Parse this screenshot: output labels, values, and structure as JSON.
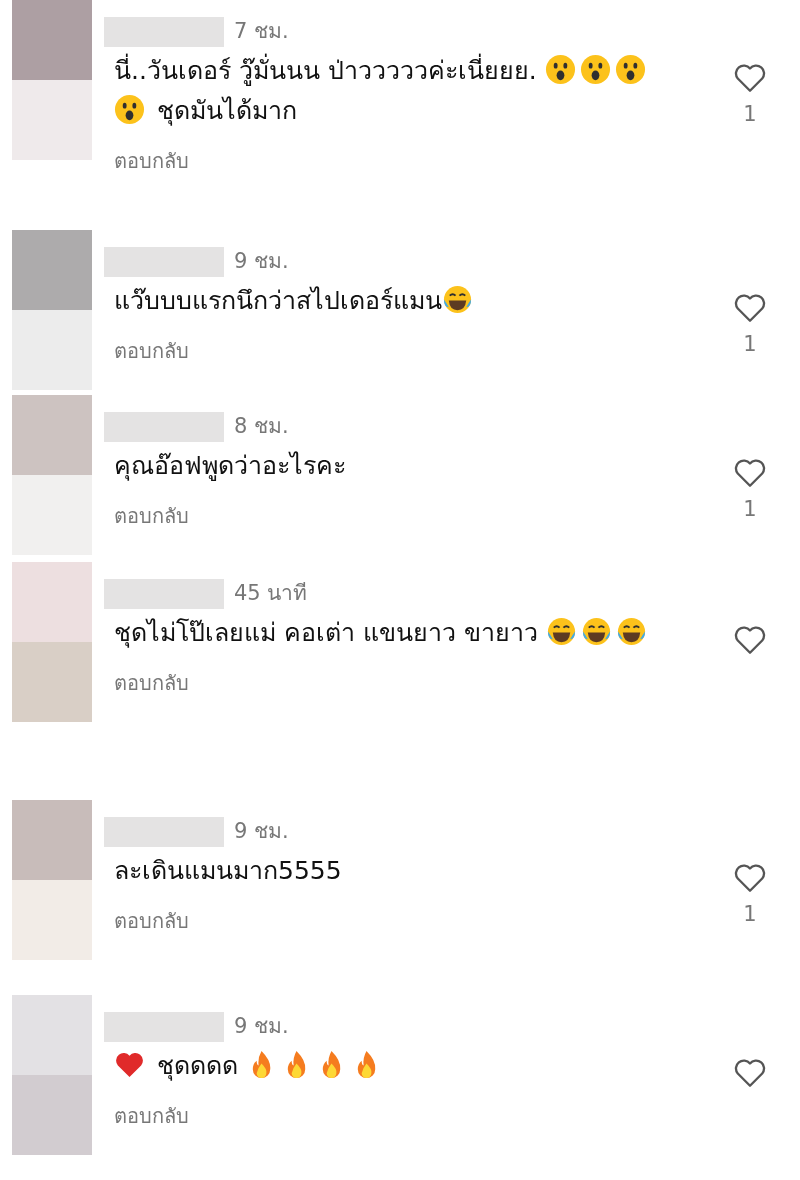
{
  "comments": [
    {
      "time": "7 ชม.",
      "body": [
        {
          "kind": "text",
          "text": "นี่..วันเดอร์ วู๊มั่นนน ป่าวววววค่ะเนี่ยยย. "
        },
        {
          "kind": "surprised"
        },
        {
          "kind": "surprised"
        },
        {
          "kind": "surprised"
        },
        {
          "kind": "surprised"
        },
        {
          "kind": "text",
          "text": " ชุดมันได้มาก"
        }
      ],
      "reply": "ตอบกลับ",
      "likes": "1"
    },
    {
      "time": "9 ชม.",
      "body": [
        {
          "kind": "text",
          "text": "แว๊บบบแรกนึกว่าสไปเดอร์แมน"
        },
        {
          "kind": "laughing"
        }
      ],
      "reply": "ตอบกลับ",
      "likes": "1"
    },
    {
      "time": "8 ชม.",
      "body": [
        {
          "kind": "text",
          "text": "คุณอ๊อฟพูดว่าอะไรคะ"
        }
      ],
      "reply": "ตอบกลับ",
      "likes": "1"
    },
    {
      "time": "45 นาที",
      "body": [
        {
          "kind": "text",
          "text": "ชุดไม่โป๊เลยแม่ คอเต่า แขนยาว ขายาว "
        },
        {
          "kind": "laughing"
        },
        {
          "kind": "laughing"
        },
        {
          "kind": "laughing"
        }
      ],
      "reply": "ตอบกลับ"
    },
    {
      "time": "9 ชม.",
      "body": [
        {
          "kind": "text",
          "text": "ละเดินแมนมาก5555"
        }
      ],
      "reply": "ตอบกลับ",
      "likes": "1"
    },
    {
      "time": "9 ชม.",
      "body": [
        {
          "kind": "heart"
        },
        {
          "kind": "text",
          "text": " ชุดดดด "
        },
        {
          "kind": "fire"
        },
        {
          "kind": "fire"
        },
        {
          "kind": "fire"
        },
        {
          "kind": "fire"
        }
      ],
      "reply": "ตอบกลับ"
    }
  ]
}
